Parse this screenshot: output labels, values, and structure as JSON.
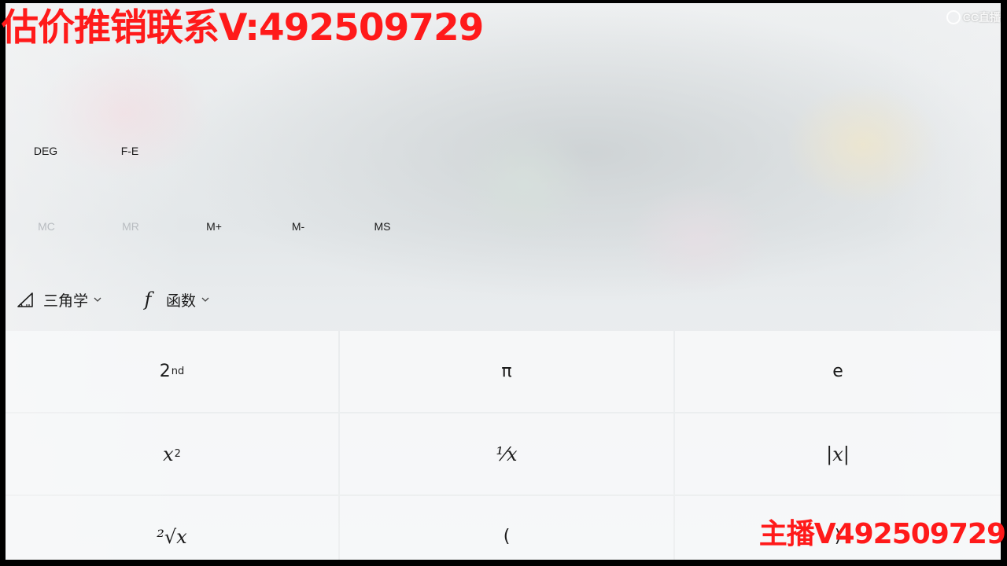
{
  "overlay": {
    "top_text": "估价推销联系V:492509729",
    "bottom_text": "主播V492509729",
    "logo_text": "CC直播"
  },
  "calculator": {
    "mode_buttons": {
      "angle": "DEG",
      "notation": "F-E"
    },
    "memory": {
      "mc": "MC",
      "mr": "MR",
      "mplus": "M+",
      "mminus": "M-",
      "ms": "MS"
    },
    "dropdowns": {
      "trigonometry": "三角学",
      "functions": "函数"
    },
    "keys": {
      "second": "2",
      "second_sup": "nd",
      "pi": "π",
      "e": "e",
      "x_squared": "x",
      "x_squared_sup": "2",
      "reciprocal": "⅟x",
      "abs": "|x|",
      "sqrt": "²√x",
      "open_paren": "(",
      "close_paren": ")"
    }
  }
}
